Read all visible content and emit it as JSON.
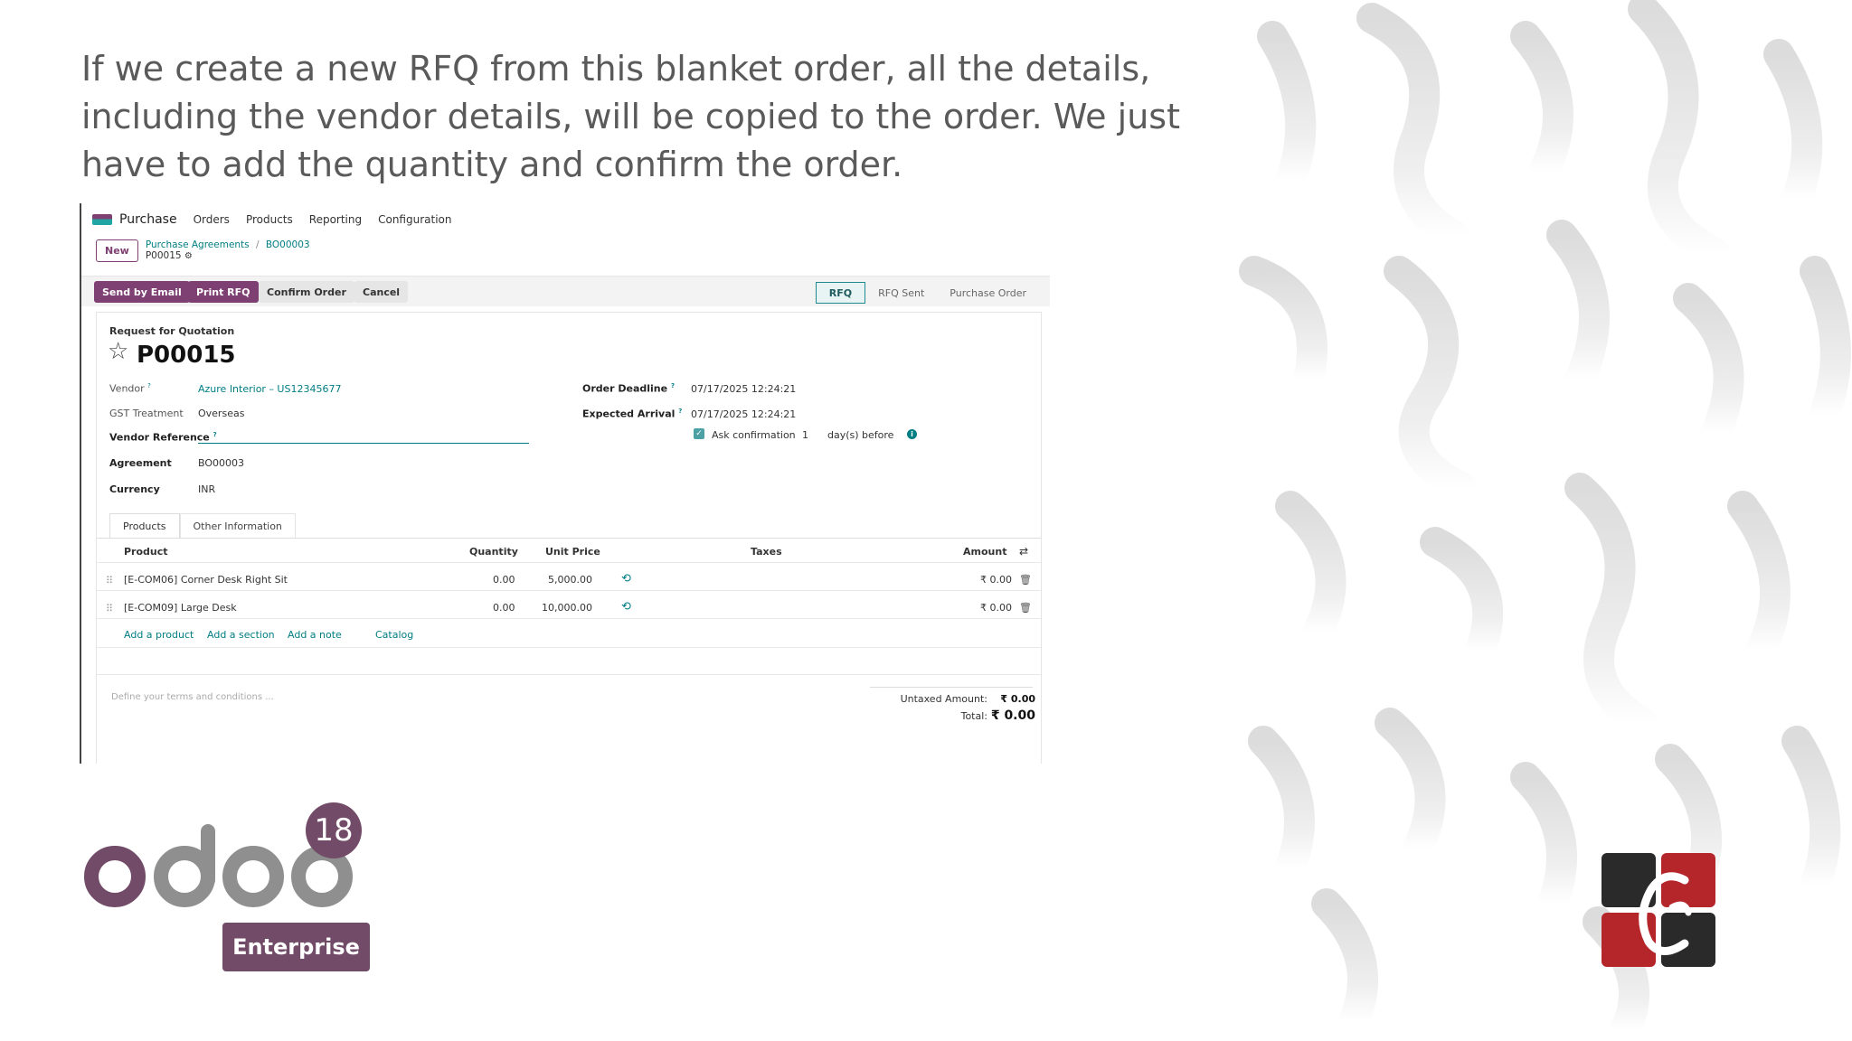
{
  "caption": "If we create a new RFQ from this blanket order, all the details, including the vendor details, will be copied to the order. We just have to add the quantity and confirm the order.",
  "topnav": {
    "app": "Purchase",
    "menu": [
      "Orders",
      "Products",
      "Reporting",
      "Configuration"
    ]
  },
  "breadcrumb": {
    "new_label": "New",
    "links": [
      "Purchase Agreements",
      "BO00003"
    ],
    "separator": "/",
    "current": "P00015"
  },
  "actions": {
    "send_email": "Send by Email",
    "print_rfq": "Print RFQ",
    "confirm": "Confirm Order",
    "cancel": "Cancel"
  },
  "statusbar": [
    "RFQ",
    "RFQ Sent",
    "Purchase Order"
  ],
  "form": {
    "subtitle": "Request for Quotation",
    "reference": "P00015",
    "vendor_label": "Vendor",
    "vendor_value": "Azure Interior – US12345677",
    "gst_label": "GST Treatment",
    "gst_value": "Overseas",
    "vendor_ref_label": "Vendor Reference",
    "agreement_label": "Agreement",
    "agreement_value": "BO00003",
    "currency_label": "Currency",
    "currency_value": "INR",
    "deadline_label": "Order Deadline",
    "deadline_value": "07/17/2025 12:24:21",
    "arrival_label": "Expected Arrival",
    "arrival_value": "07/17/2025 12:24:21",
    "ask_label": "Ask confirmation",
    "ask_days": "1",
    "ask_suffix": "day(s) before",
    "help_mark": "?"
  },
  "tabs": [
    "Products",
    "Other Information"
  ],
  "table": {
    "headers": [
      "Product",
      "Quantity",
      "Unit Price",
      "Taxes",
      "Amount"
    ],
    "rows": [
      {
        "product": "[E-COM06] Corner Desk Right Sit",
        "qty": "0.00",
        "price": "5,000.00",
        "amount": "₹ 0.00"
      },
      {
        "product": "[E-COM09] Large Desk",
        "qty": "0.00",
        "price": "10,000.00",
        "amount": "₹ 0.00"
      }
    ],
    "add_links": [
      "Add a product",
      "Add a section",
      "Add a note",
      "Catalog"
    ]
  },
  "terms_placeholder": "Define your terms and conditions ...",
  "totals": {
    "untaxed_label": "Untaxed Amount:",
    "untaxed_value": "₹ 0.00",
    "total_label": "Total:",
    "total_value": "₹ 0.00"
  },
  "branding": {
    "odoo_version": "18",
    "edition": "Enterprise"
  },
  "colors": {
    "primary": "#714b67",
    "link": "#017e84"
  }
}
